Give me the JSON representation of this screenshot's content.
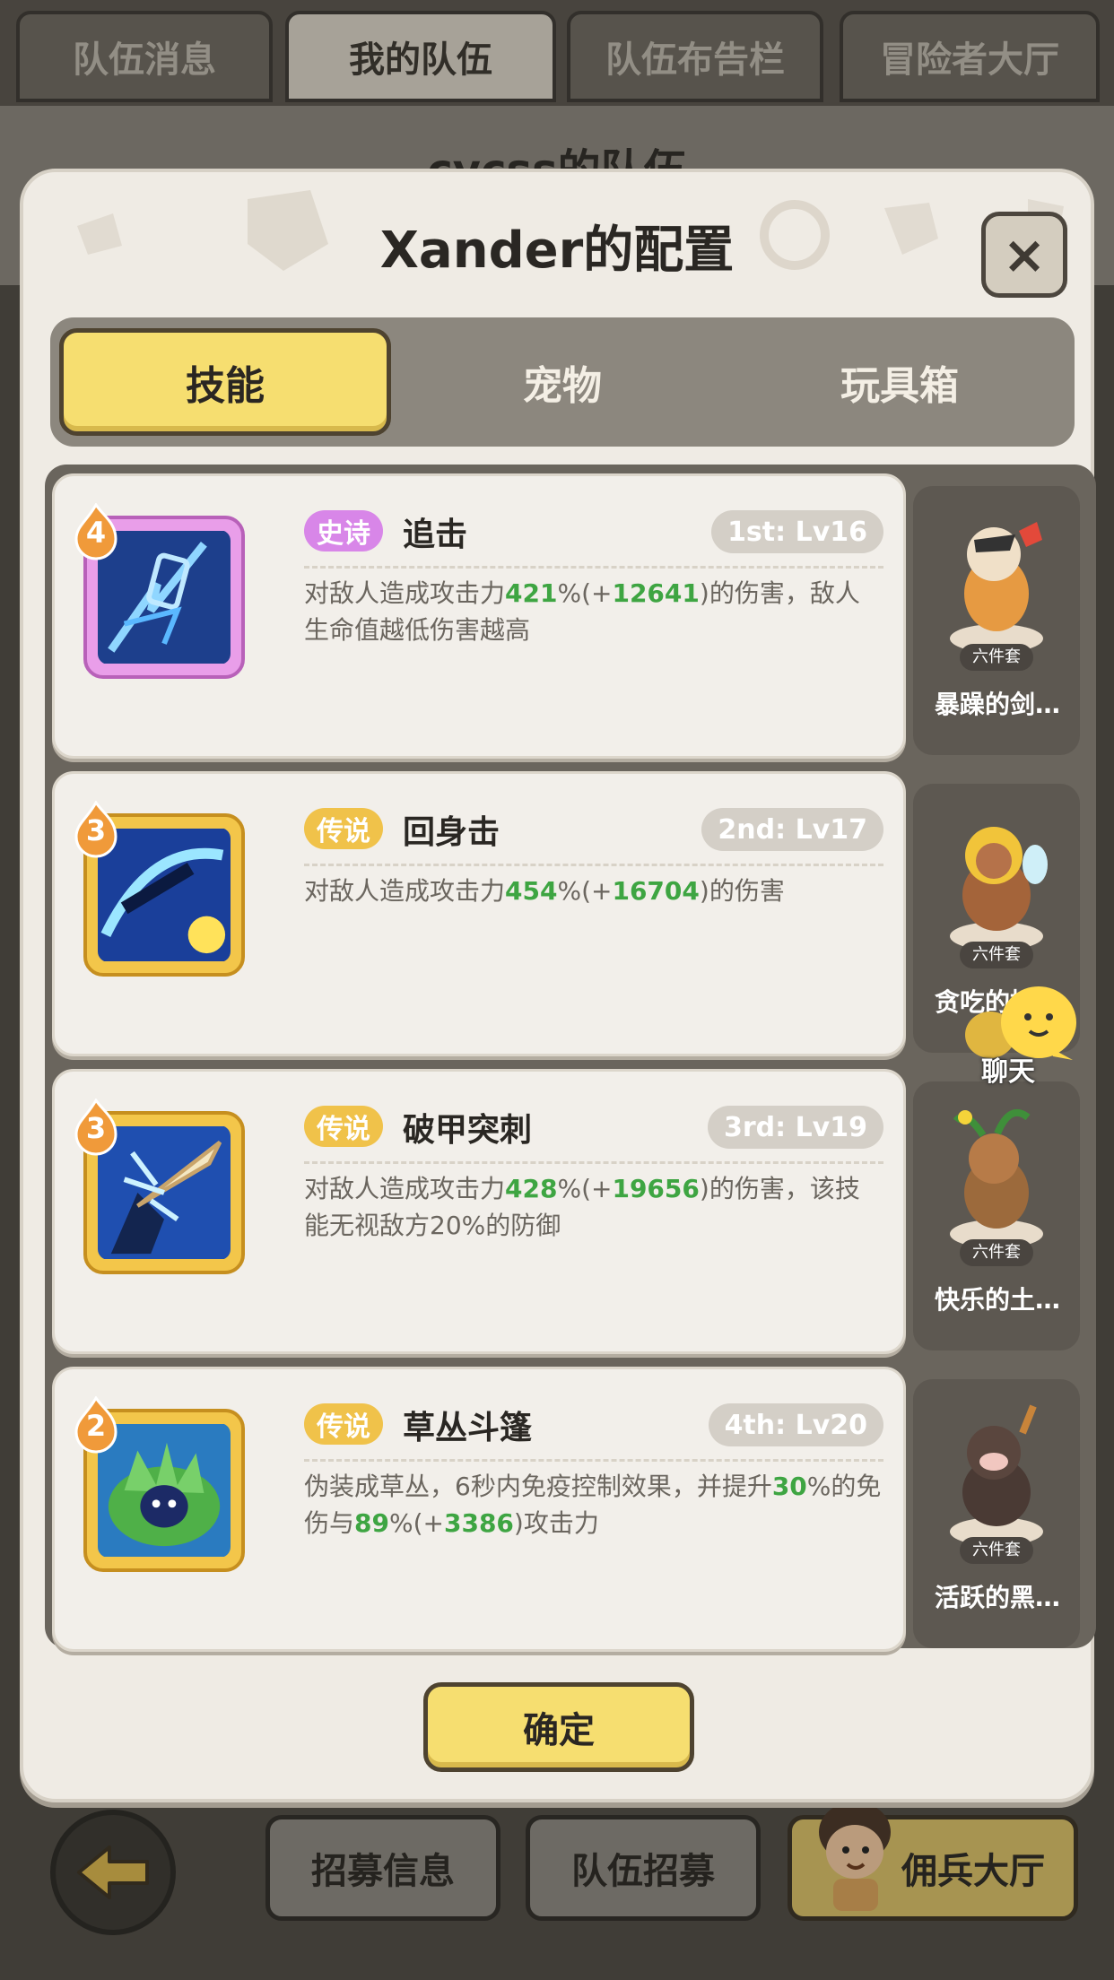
{
  "top_tabs": [
    "队伍消息",
    "我的队伍",
    "队伍布告栏",
    "冒险者大厅"
  ],
  "team_title": "cycss的队伍",
  "modal": {
    "title": "Xander的配置",
    "close_label": "×",
    "tabs": [
      "技能",
      "宠物",
      "玩具箱"
    ],
    "active_tab": "技能",
    "confirm_label": "确定"
  },
  "skills": [
    {
      "level": "4",
      "rarity": "史诗",
      "rarity_type": "epic",
      "name": "追击",
      "slot": "1st: Lv16",
      "desc_html": "对敌人造成攻击力<span class=\"g\">421</span>%(+<span class=\"g\">12641</span>)的伤害，敌人生命值越低伤害越高",
      "set_tag": "六件套",
      "set_name": "暴躁的剑…",
      "icon": "chase-skill-icon"
    },
    {
      "level": "3",
      "rarity": "传说",
      "rarity_type": "legend",
      "name": "回身击",
      "slot": "2nd: Lv17",
      "desc_html": "对敌人造成攻击力<span class=\"g\">454</span>%(+<span class=\"g\">16704</span>)的伤害",
      "set_tag": "六件套",
      "set_name": "贪吃的棕…",
      "icon": "spin-strike-icon"
    },
    {
      "level": "3",
      "rarity": "传说",
      "rarity_type": "legend",
      "name": "破甲突刺",
      "slot": "3rd: Lv19",
      "desc_html": "对敌人造成攻击力<span class=\"g\">428</span>%(+<span class=\"g\">19656</span>)的伤害，该技能无视敌方20%的防御",
      "set_tag": "六件套",
      "set_name": "快乐的土…",
      "icon": "armor-pierce-icon"
    },
    {
      "level": "2",
      "rarity": "传说",
      "rarity_type": "legend",
      "name": "草丛斗篷",
      "slot": "4th: Lv20",
      "desc_html": "伪装成草丛，6秒内免疫控制效果，并提升<span class=\"g\">30</span>%的免伤与<span class=\"g\">89</span>%(+<span class=\"g\">3386</span>)攻击力",
      "set_tag": "六件套",
      "set_name": "活跃的黑…",
      "icon": "bush-cloak-icon"
    }
  ],
  "chat_label": "聊天",
  "bottom": {
    "recruit_info": "招募信息",
    "team_recruit": "队伍招募",
    "merc_hall": "佣兵大厅"
  }
}
